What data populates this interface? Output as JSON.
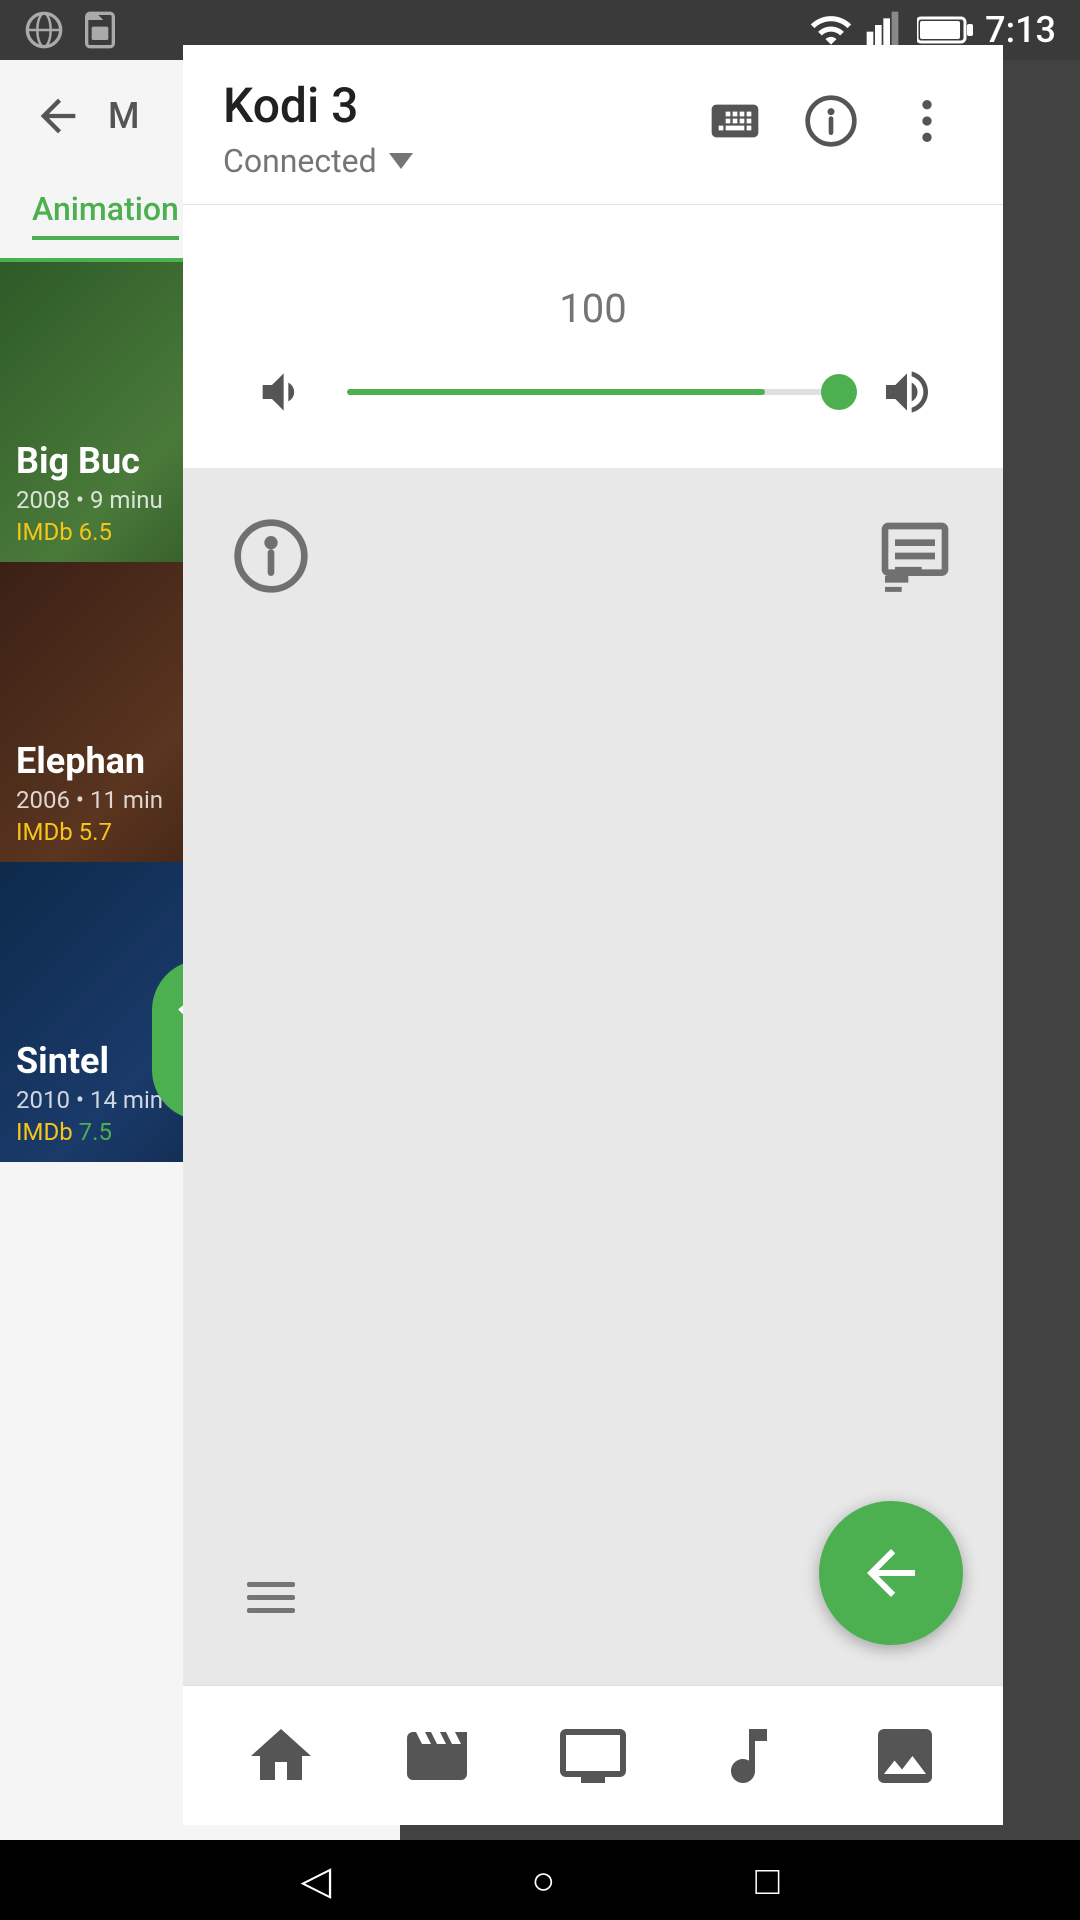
{
  "statusBar": {
    "time": "7:13",
    "leftIcons": [
      "globe-icon",
      "sim-icon"
    ],
    "rightIcons": [
      "wifi-icon",
      "signal-icon",
      "battery-icon"
    ]
  },
  "background": {
    "backArrow": "←",
    "tabActive": "Animation",
    "movies": [
      {
        "title": "Big Buc",
        "year": "2008",
        "duration": "9 minu",
        "imdbLabel": "IMDb",
        "imdbScore": "6.5",
        "imdbColor": "#f5c518"
      },
      {
        "title": "Elephan",
        "year": "2006",
        "duration": "11 min",
        "imdbLabel": "IMDb",
        "imdbScore": "5.7",
        "imdbColor": "#f5c518"
      },
      {
        "title": "Sintel",
        "year": "2010",
        "duration": "14 min",
        "imdbLabel": "IMDb",
        "imdbScore": "7.5",
        "imdbColor": "#4CAF50"
      }
    ]
  },
  "panel": {
    "title": "Kodi 3",
    "status": "Connected",
    "dropdownArrow": "▾",
    "keyboardIcon": "keyboard-icon",
    "infoIcon": "info-icon",
    "moreIcon": "more-vert-icon"
  },
  "volume": {
    "value": "100",
    "min": 0,
    "max": 100,
    "current": 85,
    "muteIcon": "volume-mute-icon",
    "volumeIcon": "volume-up-icon"
  },
  "remote": {
    "infoIcon": "info-circle-icon",
    "queueIcon": "queue-icon",
    "menuIcon": "menu-icon",
    "backIcon": "arrow-left-icon"
  },
  "bottomNav": {
    "items": [
      {
        "icon": "home-icon",
        "label": "Home"
      },
      {
        "icon": "movies-icon",
        "label": "Movies"
      },
      {
        "icon": "tv-icon",
        "label": "TV"
      },
      {
        "icon": "music-icon",
        "label": "Music"
      },
      {
        "icon": "photos-icon",
        "label": "Photos"
      }
    ]
  },
  "systemNav": {
    "back": "◁",
    "home": "○",
    "recent": "□"
  }
}
